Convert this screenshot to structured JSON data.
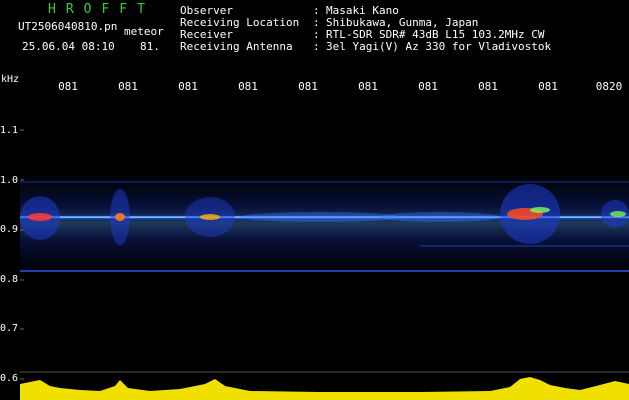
{
  "header": {
    "brand": "HROFFT",
    "filename": "UT2506040810.pn",
    "extension": "meteor",
    "datetime": "25.06.04 08:10",
    "count": "81."
  },
  "station": {
    "rows": [
      {
        "key": "Observer",
        "colon": ":",
        "value": "Masaki Kano"
      },
      {
        "key": "Receiving Location",
        "colon": ":",
        "value": "Shibukawa, Gunma, Japan"
      },
      {
        "key": "Receiver",
        "colon": ":",
        "value": "RTL-SDR SDR# 43dB L15 103.2MHz CW"
      },
      {
        "key": "Receiving Antenna",
        "colon": ":",
        "value": "3el Yagi(V) Az 330 for Vladivostok"
      }
    ]
  },
  "axis": {
    "unit": "kHz",
    "x_ticks": [
      "081",
      "081",
      "081",
      "081",
      "081",
      "081",
      "081",
      "081",
      "081",
      "0820"
    ],
    "y_ticks": [
      "1.1",
      "1.0",
      "0.9",
      "0.8",
      "0.7",
      "0.6"
    ]
  },
  "colors": {
    "background": "#000000",
    "brand": "#2fcf2f",
    "signal": "#3a7bff",
    "level_bar": "#f0e000",
    "level_base": "#7fd0ff"
  }
}
